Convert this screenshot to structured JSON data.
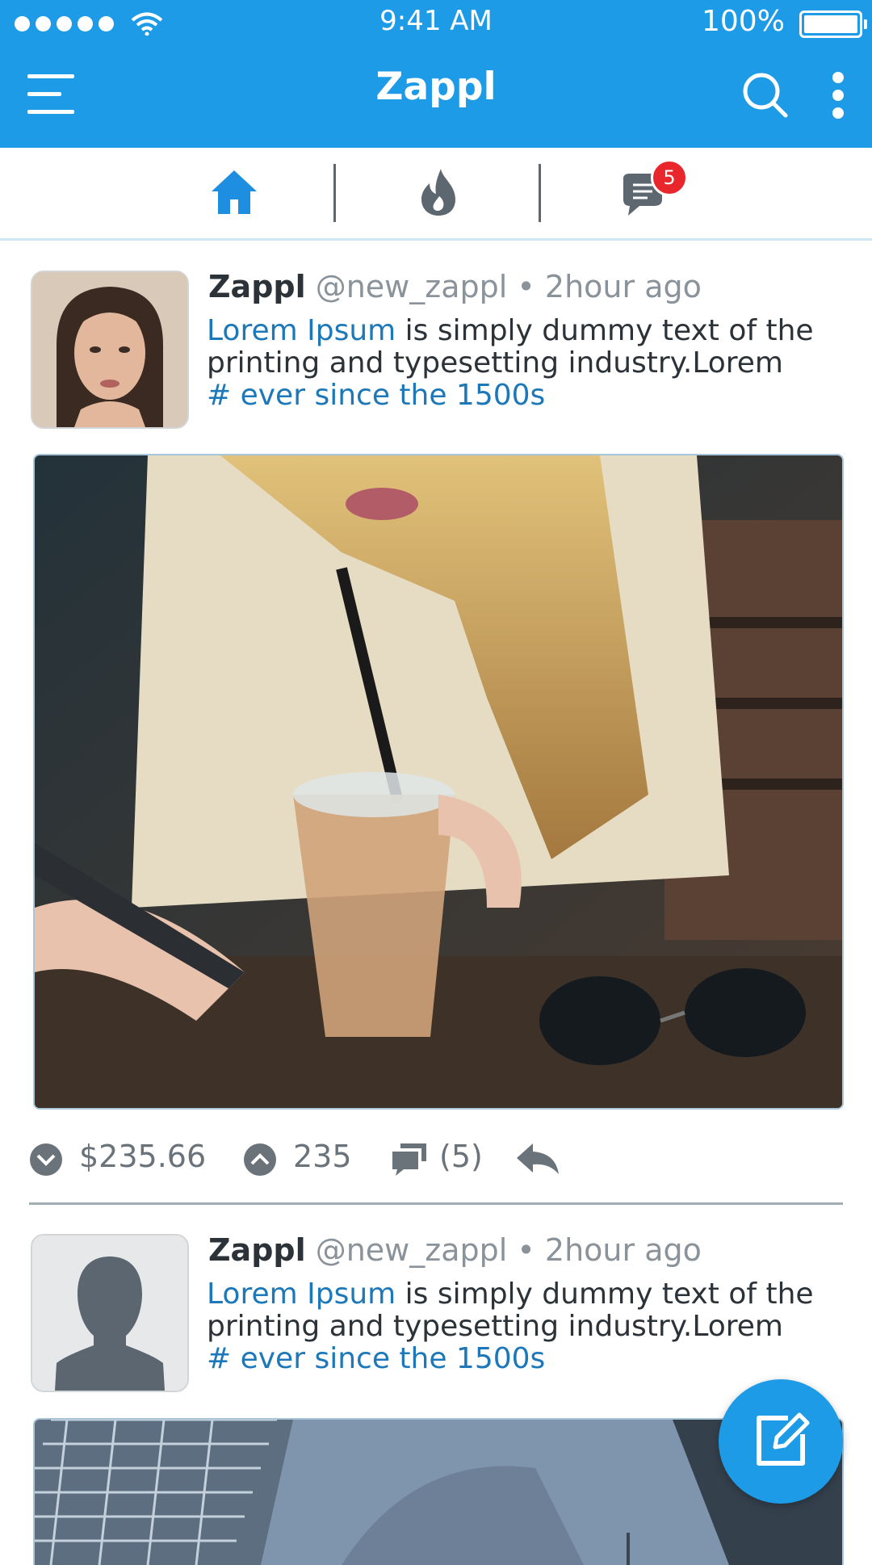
{
  "status_bar": {
    "time": "9:41 AM",
    "battery": "100%"
  },
  "app": {
    "title": "Zappl"
  },
  "tabs": {
    "messages_badge": "5"
  },
  "posts": [
    {
      "name": "Zappl",
      "handle": "@new_zappl",
      "separator": "•",
      "time_ago": "2hour ago",
      "text_link": "Lorem Ipsum",
      "text_main": " is simply dummy text of the printing and typesetting industry.Lorem",
      "hashtag": "# ever since the 1500s"
    },
    {
      "name": "Zappl",
      "handle": "@new_zappl",
      "separator": "•",
      "time_ago": "2hour ago",
      "text_link": "Lorem Ipsum",
      "text_main": " is simply dummy text of the printing and typesetting industry.Lorem",
      "hashtag": "# ever since the 1500s"
    }
  ],
  "actions": {
    "price": "$235.66",
    "upvotes": "235",
    "comments": "(5)"
  },
  "colors": {
    "primary": "#1e9be6",
    "link": "#1c78b8",
    "badge": "#e8262b",
    "text": "#2b3238",
    "muted": "#8a939a"
  },
  "icons": [
    "menu-icon",
    "search-icon",
    "more-vertical-icon",
    "home-icon",
    "flame-icon",
    "chat-icon",
    "chevron-down-circle-icon",
    "chevron-up-circle-icon",
    "comments-icon",
    "reply-icon",
    "compose-icon",
    "person-placeholder-icon"
  ]
}
